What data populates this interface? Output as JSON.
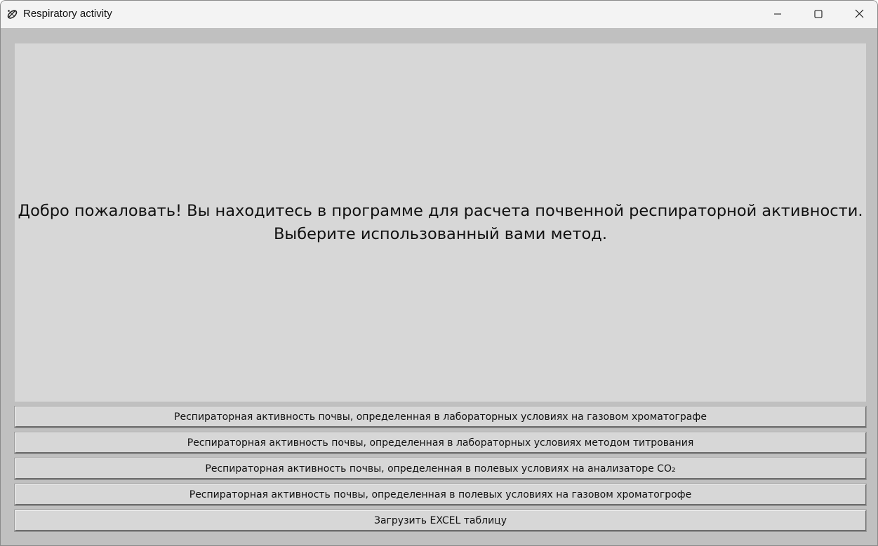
{
  "window": {
    "title": "Respiratory activity",
    "controls": {
      "minimize": "minimize",
      "maximize": "maximize",
      "close": "close"
    }
  },
  "welcome": {
    "line1": "Добро пожаловать! Вы находитесь в программе для расчета почвенной респираторной активности.",
    "line2": "Выберите использованный вами метод."
  },
  "buttons": [
    {
      "label": "Респираторная активность почвы, определенная в лабораторных условиях на газовом хроматографе"
    },
    {
      "label": "Респираторная активность почвы, определенная в лабораторных условиях методом титрования"
    },
    {
      "label": "Респираторная активность почвы, определенная в полевых условиях на анализаторе CO₂"
    },
    {
      "label": "Респираторная активность почвы, определенная в полевых условиях на газовом хроматогрофе"
    },
    {
      "label": "Загрузить EXCEL таблицу"
    }
  ],
  "icons": {
    "app": "tkinter-feather-icon",
    "minimize": "minimize-icon",
    "maximize": "maximize-icon",
    "close": "close-icon"
  },
  "colors": {
    "window_bg": "#c0c0c0",
    "panel_bg": "#d7d7d7",
    "titlebar_bg": "#f3f3f3"
  }
}
